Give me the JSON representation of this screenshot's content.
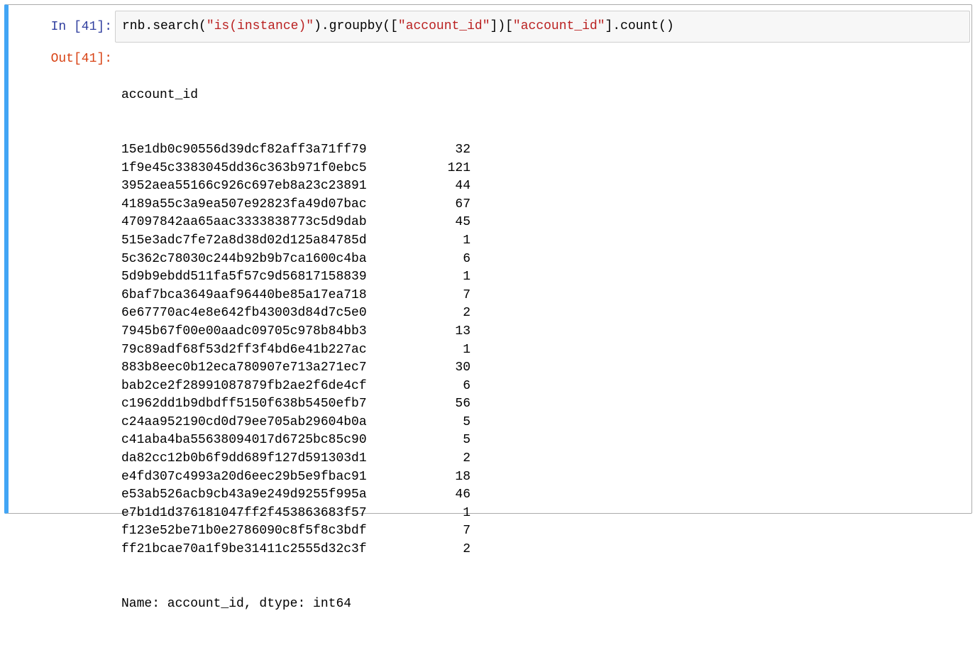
{
  "cell": {
    "selected_color": "#42a5f5",
    "in_prompt": "In [41]:",
    "out_prompt": "Out[41]:",
    "code": {
      "part1": "rnb.search(",
      "str1": "\"is(instance)\"",
      "part2": ").groupby([",
      "str2": "\"account_id\"",
      "part3": "])[",
      "str3": "\"account_id\"",
      "part4": "].count()"
    },
    "output": {
      "index_name": "account_id",
      "rows": [
        {
          "id": "15e1db0c90556d39dcf82aff3a71ff79",
          "count": "32"
        },
        {
          "id": "1f9e45c3383045dd36c363b971f0ebc5",
          "count": "121"
        },
        {
          "id": "3952aea55166c926c697eb8a23c23891",
          "count": "44"
        },
        {
          "id": "4189a55c3a9ea507e92823fa49d07bac",
          "count": "67"
        },
        {
          "id": "47097842aa65aac3333838773c5d9dab",
          "count": "45"
        },
        {
          "id": "515e3adc7fe72a8d38d02d125a84785d",
          "count": "1"
        },
        {
          "id": "5c362c78030c244b92b9b7ca1600c4ba",
          "count": "6"
        },
        {
          "id": "5d9b9ebdd511fa5f57c9d56817158839",
          "count": "1"
        },
        {
          "id": "6baf7bca3649aaf96440be85a17ea718",
          "count": "7"
        },
        {
          "id": "6e67770ac4e8e642fb43003d84d7c5e0",
          "count": "2"
        },
        {
          "id": "7945b67f00e00aadc09705c978b84bb3",
          "count": "13"
        },
        {
          "id": "79c89adf68f53d2ff3f4bd6e41b227ac",
          "count": "1"
        },
        {
          "id": "883b8eec0b12eca780907e713a271ec7",
          "count": "30"
        },
        {
          "id": "bab2ce2f28991087879fb2ae2f6de4cf",
          "count": "6"
        },
        {
          "id": "c1962dd1b9dbdff5150f638b5450efb7",
          "count": "56"
        },
        {
          "id": "c24aa952190cd0d79ee705ab29604b0a",
          "count": "5"
        },
        {
          "id": "c41aba4ba55638094017d6725bc85c90",
          "count": "5"
        },
        {
          "id": "da82cc12b0b6f9dd689f127d591303d1",
          "count": "2"
        },
        {
          "id": "e4fd307c4993a20d6eec29b5e9fbac91",
          "count": "18"
        },
        {
          "id": "e53ab526acb9cb43a9e249d9255f995a",
          "count": "46"
        },
        {
          "id": "e7b1d1d376181047ff2f453863683f57",
          "count": "1"
        },
        {
          "id": "f123e52be71b0e2786090c8f5f8c3bdf",
          "count": "7"
        },
        {
          "id": "ff21bcae70a1f9be31411c2555d32c3f",
          "count": "2"
        }
      ],
      "footer": "Name: account_id, dtype: int64"
    }
  }
}
